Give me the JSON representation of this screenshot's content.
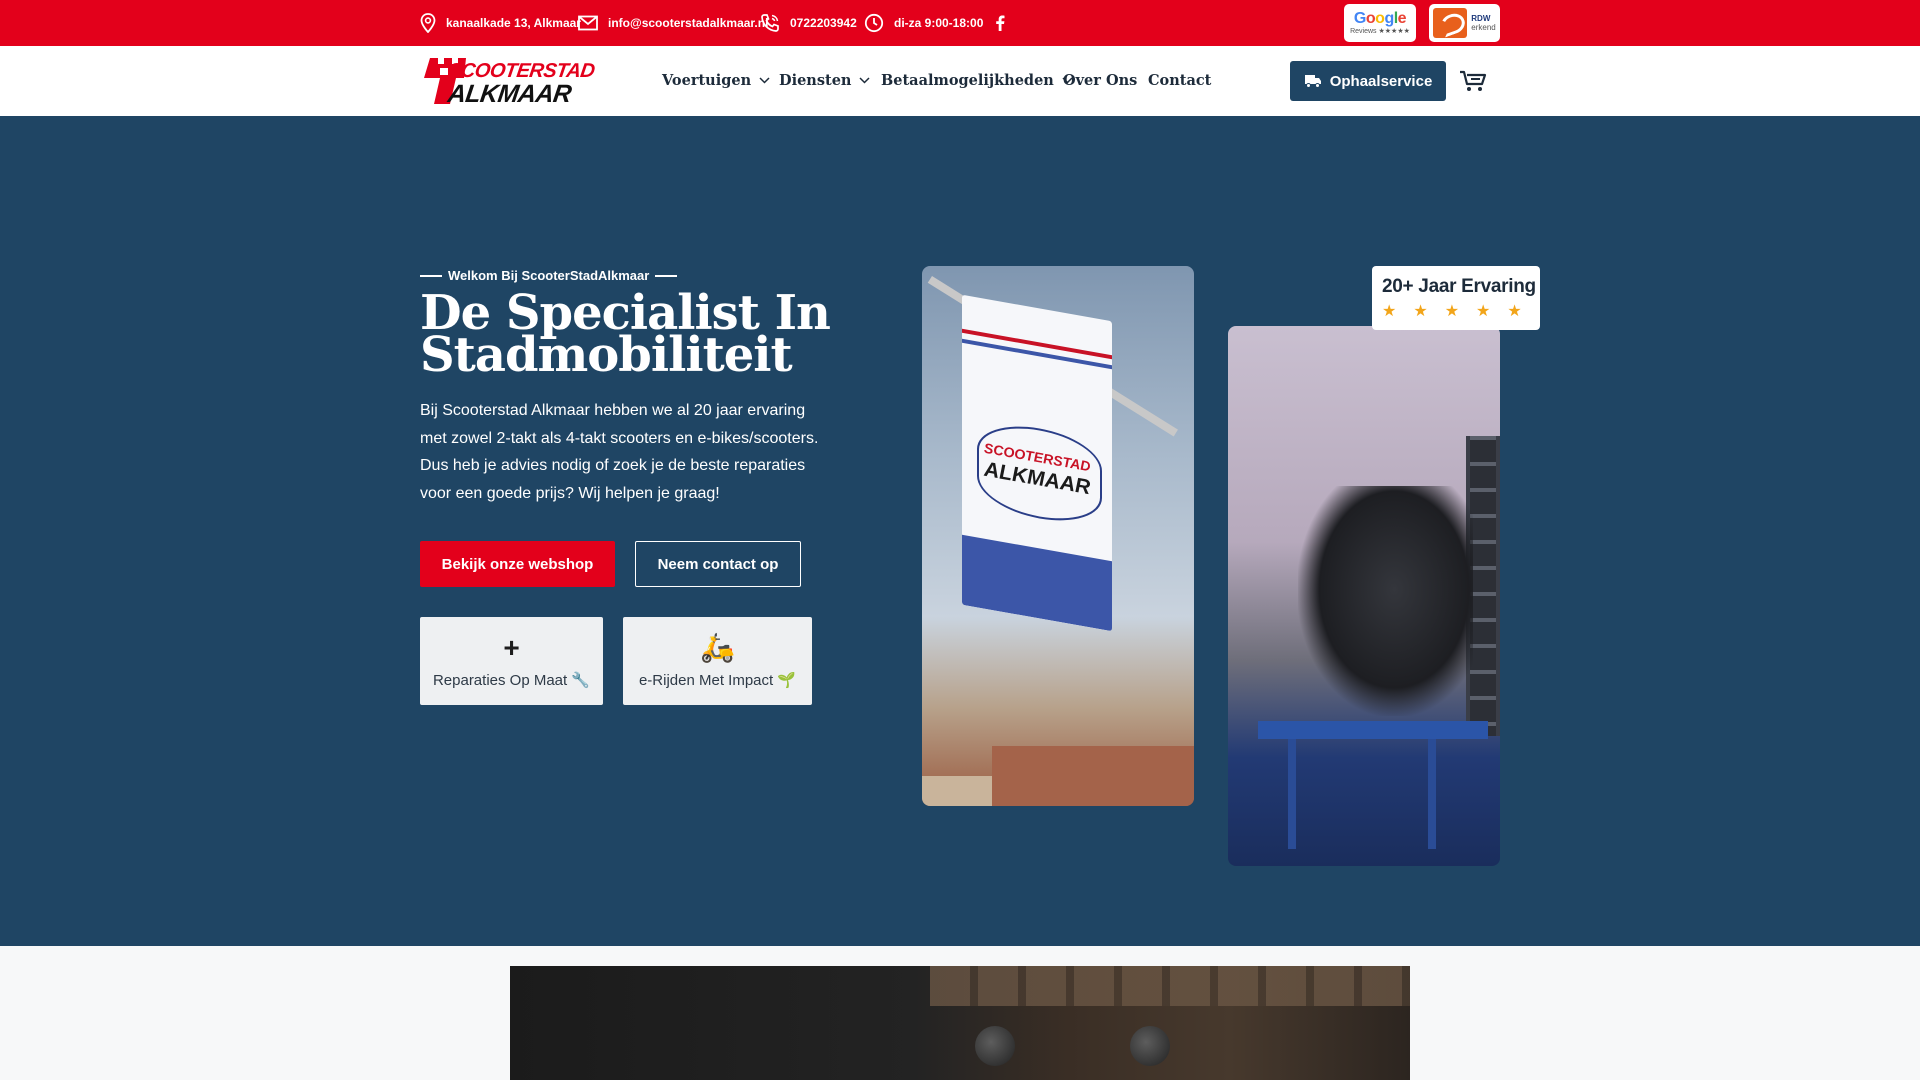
{
  "topbar": {
    "address": "kanaalkade 13, Alkmaar",
    "email": "info@scooterstadalkmaar.nl",
    "phone": "0722203942",
    "hours": "di-za 9:00-18:00",
    "social_icon": "facebook-icon",
    "google_badge": {
      "word": "Google",
      "sub": "Reviews ★★★★★"
    },
    "rdw_badge": {
      "text1": "RDW",
      "text2": "erkend"
    }
  },
  "nav": {
    "logo_top": "SCOOTERSTAD",
    "logo_bottom": "ALKMAAR",
    "items": [
      {
        "label": "Voertuigen",
        "dropdown": true
      },
      {
        "label": "Diensten",
        "dropdown": true
      },
      {
        "label": "Betaalmogelijkheden",
        "dropdown": true
      },
      {
        "label": "Over Ons",
        "dropdown": false
      },
      {
        "label": "Contact",
        "dropdown": false
      }
    ],
    "cta": "Ophaalservice",
    "cart_icon": "cart-icon"
  },
  "hero": {
    "eyebrow": "Welkom Bij ScooterStadAlkmaar",
    "title": "De Specialist In Stadmobiliteit",
    "text": "Bij Scooterstad Alkmaar hebben we al 20 jaar ervaring met zowel 2-takt als 4-takt scooters en e-bikes/scooters. Dus heb je advies nodig of zoek je de beste reparaties voor een goede prijs? Wij helpen je graag!",
    "primary_button": "Bekijk onze webshop",
    "secondary_button": "Neem contact op",
    "features": [
      {
        "icon": "+",
        "label": "Reparaties Op Maat 🔧"
      },
      {
        "icon": "🛵",
        "label": "e-Rijden Met Impact 🌱"
      }
    ],
    "flag_text_top": "SCOOTERSTAD",
    "flag_text_bottom": "ALKMAAR",
    "experience": {
      "title": "20+ Jaar Ervaring",
      "stars": "★★★★★"
    }
  },
  "colors": {
    "brand_red": "#e3001b",
    "navy": "#1f4564",
    "star": "#f2a51a"
  }
}
